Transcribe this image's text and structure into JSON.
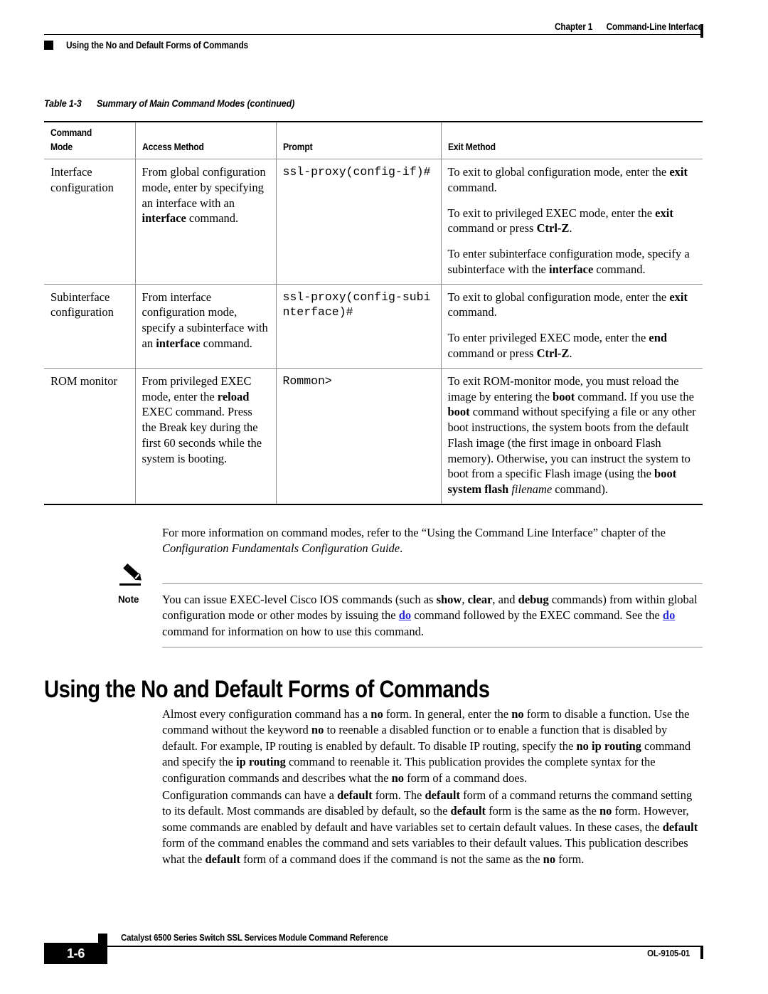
{
  "header": {
    "chapter": "Chapter 1",
    "chapter_title": "Command-Line Interface",
    "section_marker": "square-marker",
    "running_title": "Using the No and Default Forms of Commands"
  },
  "table": {
    "caption_number": "Table 1-3",
    "caption_text": "Summary of Main Command Modes (continued)",
    "columns": [
      "Command\nMode",
      "Access Method",
      "Prompt",
      "Exit Method"
    ],
    "column_headers": {
      "command_mode_line1": "Command",
      "command_mode_line2": "Mode",
      "access_method": "Access Method",
      "prompt": "Prompt",
      "exit_method": "Exit Method"
    },
    "rows": [
      {
        "mode": "Interface configuration",
        "access_method_plain": "From global configuration mode, enter by specifying an interface with an ",
        "access_method_bold": "interface",
        "access_method_tail": " command.",
        "prompt": "ssl-proxy(config-if)#",
        "exit_paragraphs": [
          {
            "pre": "To exit to global configuration mode, enter the ",
            "bold1": "exit",
            "mid": " command.",
            "bold2": "",
            "post": ""
          },
          {
            "pre": "To exit to privileged EXEC mode, enter the ",
            "bold1": "exit",
            "mid": " command or press ",
            "bold2": "Ctrl-Z",
            "post": "."
          },
          {
            "pre": "To enter subinterface configuration mode, specify a subinterface with the ",
            "bold1": "interface",
            "mid": " command.",
            "bold2": "",
            "post": ""
          }
        ]
      },
      {
        "mode": "Subinterface configuration",
        "access_method_plain": "From interface configuration mode, specify a subinterface with an ",
        "access_method_bold": "interface",
        "access_method_tail": " command.",
        "prompt": "ssl-proxy(config-subinterface)#",
        "exit_paragraphs": [
          {
            "pre": "To exit to global configuration mode, enter the ",
            "bold1": "exit",
            "mid": " command.",
            "bold2": "",
            "post": ""
          },
          {
            "pre": "To enter privileged EXEC mode, enter the ",
            "bold1": "end",
            "mid": " command or press ",
            "bold2": "Ctrl-Z",
            "post": "."
          }
        ]
      },
      {
        "mode": "ROM monitor",
        "access_method_plain": "From privileged EXEC mode, enter the ",
        "access_method_bold": "reload",
        "access_method_tail": " EXEC command. Press the Break key during the first 60 seconds while the system is booting.",
        "prompt": "Rommon>",
        "exit_paragraphs": [
          {
            "pre": "To exit ROM-monitor mode, you must reload the image by entering the ",
            "bold1": "boot",
            "mid": " command. If you use the ",
            "bold2": "boot",
            "post": " command without specifying a file or any other boot instructions, the system boots from the default Flash image (the first image in onboard Flash memory). Otherwise, you can instruct the system to boot from a specific Flash image (using the ",
            "bold3": "boot system flash",
            "italic1": "filename",
            "tail": " command)."
          }
        ]
      }
    ]
  },
  "after_table_paragraph": {
    "pre": "For more information on command modes, refer to the “Using the Command Line Interface” chapter of the ",
    "italic": "Configuration Fundamentals Configuration Guide",
    "post": "."
  },
  "note": {
    "icon": "pencil-icon",
    "label": "Note",
    "p1_pre": "You can issue EXEC-level Cisco IOS commands (such as ",
    "p1_b1": "show",
    "p1_m1": ", ",
    "p1_b2": "clear",
    "p1_m2": ", and ",
    "p1_b3": "debug",
    "p1_m3": " commands) from within global configuration mode or other modes by issuing the ",
    "p1_link1": "do",
    "p1_m4": " command followed by the EXEC command. See the ",
    "p1_link2": "do",
    "p1_m5": " command for information on how to use this command.",
    "link_color": "#2828d8"
  },
  "section": {
    "heading": "Using the No and Default Forms of Commands",
    "paragraph1": {
      "s1": "Almost every configuration command has a ",
      "b1": "no",
      "s2": " form. In general, enter the ",
      "b2": "no",
      "s3": " form to disable a function. Use the command without the keyword ",
      "b3": "no",
      "s4": " to reenable a disabled function or to enable a function that is disabled by default. For example, IP routing is enabled by default. To disable IP routing, specify the ",
      "b4": "no ip routing",
      "s5": " command and specify the ",
      "b5": "ip routing",
      "s6": " command to reenable it. This publication provides the complete syntax for the configuration commands and describes what the ",
      "b6": "no",
      "s7": " form of a command does."
    },
    "paragraph2": {
      "s1": "Configuration commands can have a ",
      "b1": "default",
      "s2": " form. The ",
      "b2": "default",
      "s3": " form of a command returns the command setting to its default. Most commands are disabled by default, so the ",
      "b3": "default",
      "s4": " form is the same as the ",
      "b4": "no",
      "s5": " form. However, some commands are enabled by default and have variables set to certain default values. In these cases, the ",
      "b5": "default",
      "s6": " form of the command enables the command and sets variables to their default values. This publication describes what the ",
      "b6": "default",
      "s7": " form of a command does if the command is not the same as the ",
      "b7": "no",
      "s8": " form."
    }
  },
  "footer": {
    "page_number": "1-6",
    "document_title": "Catalyst 6500 Series Switch SSL Services Module Command Reference",
    "document_id": "OL-9105-01"
  }
}
